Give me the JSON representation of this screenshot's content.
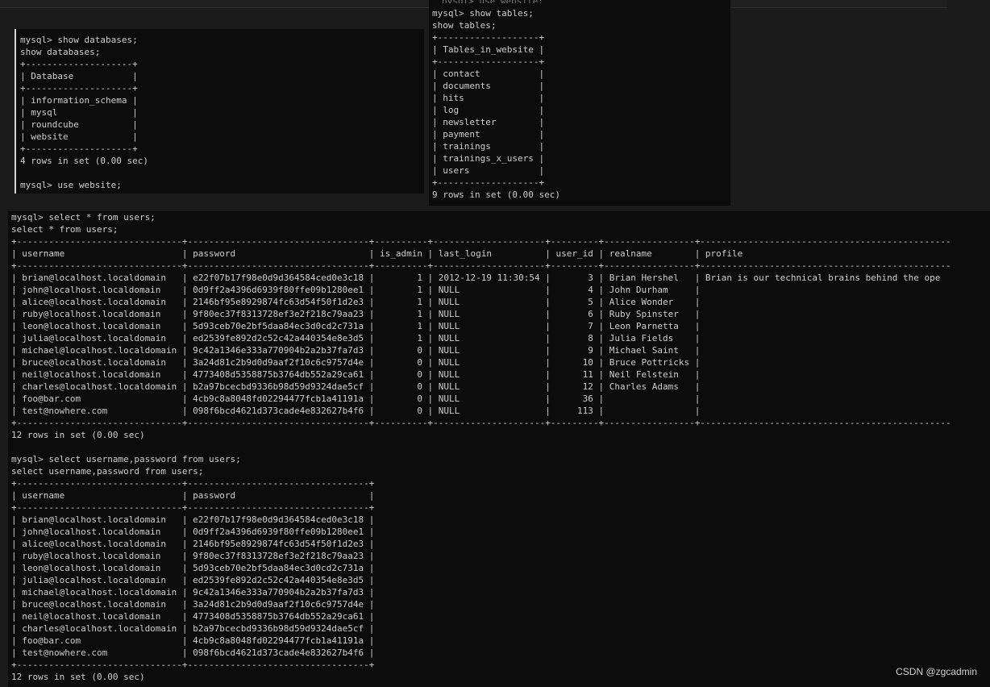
{
  "window": {
    "partial_top_text": "nysql> use website;"
  },
  "terminal_databases": {
    "lines": "mysql> show databases;\nshow databases;\n+--------------------+\n| Database           |\n+--------------------+\n| information_schema |\n| mysql              |\n| roundcube          |\n| website            |\n+--------------------+\n4 rows in set (0.00 sec)\n\nmysql> use website;"
  },
  "terminal_tables": {
    "lines": "mysql> show tables;\nshow tables;\n+-------------------+\n| Tables_in_website |\n+-------------------+\n| contact           |\n| documents         |\n| hits              |\n| log               |\n| newsletter        |\n| payment           |\n| trainings         |\n| trainings_x_users |\n| users             |\n+-------------------+\n9 rows in set (0.00 sec)"
  },
  "terminal_users": {
    "lines": "mysql> select * from users;\nselect * from users;\n+-------------------------------+----------------------------------+----------+---------------------+---------+-----------------+-----------------------------------------------\n| username                      | password                         | is_admin | last_login          | user_id | realname        | profile\n+-------------------------------+----------------------------------+----------+---------------------+---------+-----------------+-----------------------------------------------\n| brian@localhost.localdomain   | e22f07b17f98e0d9d364584ced0e3c18 |        1 | 2012-12-19 11:30:54 |       3 | Brian Hershel   | Brian is our technical brains behind the ope\n| john@localhost.localdomain    | 0d9ff2a4396d6939f80ffe09b1280ee1 |        1 | NULL                |       4 | John Durham     |\n| alice@localhost.localdomain   | 2146bf95e8929874fc63d54f50f1d2e3 |        1 | NULL                |       5 | Alice Wonder    |\n| ruby@localhost.localdomain    | 9f80ec37f8313728ef3e2f218c79aa23 |        1 | NULL                |       6 | Ruby Spinster   |\n| leon@localhost.localdomain    | 5d93ceb70e2bf5daa84ec3d0cd2c731a |        1 | NULL                |       7 | Leon Parnetta   |\n| julia@localhost.localdomain   | ed2539fe892d2c52c42a440354e8e3d5 |        1 | NULL                |       8 | Julia Fields    |\n| michael@localhost.localdomain | 9c42a1346e333a770904b2a2b37fa7d3 |        0 | NULL                |       9 | Michael Saint   |\n| bruce@localhost.localdomain   | 3a24d81c2b9d0d9aaf2f10c6c9757d4e |        0 | NULL                |      10 | Bruce Pottricks |\n| neil@localhost.localdomain    | 4773408d5358875b3764db552a29ca61 |        0 | NULL                |      11 | Neil Felstein   |\n| charles@localhost.localdomain | b2a97bcecbd9336b98d59d9324dae5cf |        0 | NULL                |      12 | Charles Adams   |\n| foo@bar.com                   | 4cb9c8a8048fd02294477fcb1a41191a |        0 | NULL                |      36 |                 |\n| test@nowhere.com              | 098f6bcd4621d373cade4e832627b4f6 |        0 | NULL                |     113 |                 |\n+-------------------------------+----------------------------------+----------+---------------------+---------+-----------------+-----------------------------------------------\n12 rows in set (0.00 sec)\n\nmysql> select username,password from users;\nselect username,password from users;\n+-------------------------------+----------------------------------+\n| username                      | password                         |\n+-------------------------------+----------------------------------+\n| brian@localhost.localdomain   | e22f07b17f98e0d9d364584ced0e3c18 |\n| john@localhost.localdomain    | 0d9ff2a4396d6939f80ffe09b1280ee1 |\n| alice@localhost.localdomain   | 2146bf95e8929874fc63d54f50f1d2e3 |\n| ruby@localhost.localdomain    | 9f80ec37f8313728ef3e2f218c79aa23 |\n| leon@localhost.localdomain    | 5d93ceb70e2bf5daa84ec3d0cd2c731a |\n| julia@localhost.localdomain   | ed2539fe892d2c52c42a440354e8e3d5 |\n| michael@localhost.localdomain | 9c42a1346e333a770904b2a2b37fa7d3 |\n| bruce@localhost.localdomain   | 3a24d81c2b9d0d9aaf2f10c6c9757d4e |\n| neil@localhost.localdomain    | 4773408d5358875b3764db552a29ca61 |\n| charles@localhost.localdomain | b2a97bcecbd9336b98d59d9324dae5cf |\n| foo@bar.com                   | 4cb9c8a8048fd02294477fcb1a41191a |\n| test@nowhere.com              | 098f6bcd4621d373cade4e832627b4f6 |\n+-------------------------------+----------------------------------+\n12 rows in set (0.00 sec)"
  },
  "watermark": {
    "text": "CSDN @zgcadmin"
  },
  "colors": {
    "terminal_bg": "#0c0c0c",
    "terminal_text": "#cccccc",
    "page_bg": "#1b1b1b"
  }
}
